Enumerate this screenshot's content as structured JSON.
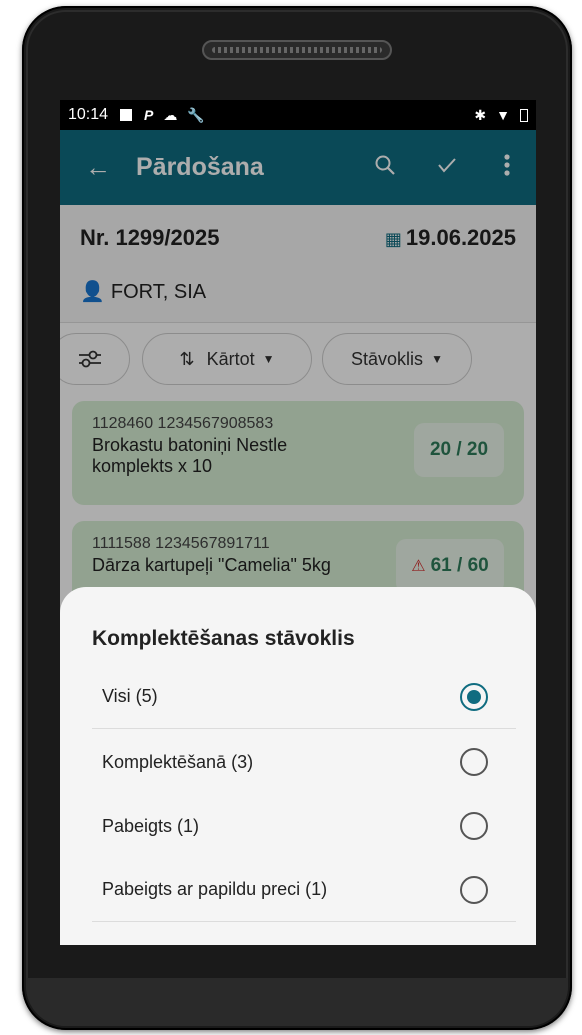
{
  "status_bar": {
    "time": "10:14"
  },
  "app_bar": {
    "title": "Pārdošana"
  },
  "document": {
    "number": "Nr. 1299/2025",
    "date": "19.06.2025",
    "client": "FORT, SIA"
  },
  "filters": {
    "sort_label": "Kārtot",
    "state_label": "Stāvoklis"
  },
  "items": [
    {
      "code": "1128460 1234567908583",
      "name": "Brokastu batoniņi Nestle komplekts x 10",
      "qty": "20 / 20"
    },
    {
      "code": "1111588 1234567891711",
      "name": "Dārza kartupeļi \"Camelia\" 5kg",
      "qty": "61 / 60"
    }
  ],
  "sheet": {
    "title": "Komplektēšanas stāvoklis",
    "options": [
      {
        "label": "Visi (5)",
        "selected": true
      },
      {
        "label": "Komplektēšanā (3)",
        "selected": false
      },
      {
        "label": "Pabeigts (1)",
        "selected": false
      },
      {
        "label": "Pabeigts ar papildu preci (1)",
        "selected": false
      }
    ]
  },
  "colors": {
    "primary": "#0f6c80",
    "item_bg": "#d7efd5",
    "qty_text": "#2e7d5a",
    "warning": "#d32f2f"
  }
}
